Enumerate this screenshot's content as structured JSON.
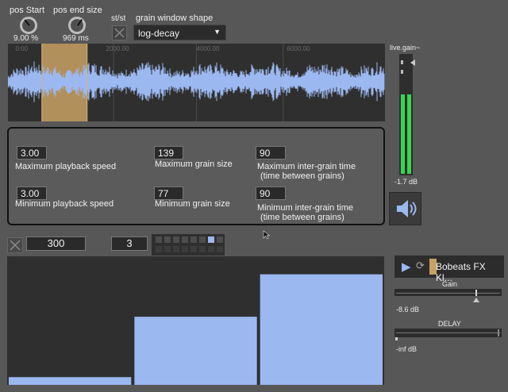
{
  "params": {
    "pos_start": {
      "label": "pos Start",
      "value": "9.00 %"
    },
    "pos_end_size": {
      "label": "pos end size",
      "value": "969 ms"
    },
    "stst_label": "st/st",
    "grain_window": {
      "label": "grain window shape",
      "selected": "log-decay"
    }
  },
  "waveform": {
    "ruler_ticks": [
      "0:00",
      "2000.00",
      "4000.00",
      "6000.00"
    ],
    "selection_start_fraction": 0.09,
    "selection_end_fraction": 0.21
  },
  "gain_meter": {
    "label": "live.gain~",
    "value": "-1.7 dB",
    "level": 0.8
  },
  "controls": {
    "max_speed": {
      "value": "3.00",
      "label": "Maximum playback speed"
    },
    "max_grain": {
      "value": "139",
      "label": "Maximum grain size"
    },
    "max_inter": {
      "value": "90",
      "label_line1": "Maximum inter-grain time",
      "label_line2": "(time between grains)"
    },
    "min_speed": {
      "value": "3.00",
      "label": "Minimum playback speed"
    },
    "min_grain": {
      "value": "77",
      "label": "Minimum grain size"
    },
    "min_inter": {
      "value": "90",
      "label_line1": "Minimum inter-grain time",
      "label_line2": "(time between grains)"
    }
  },
  "lower": {
    "rate_value": "300",
    "steps_value": "3",
    "active_step": 6
  },
  "bars": {
    "values": [
      0.06,
      0.53,
      0.86
    ],
    "color": "#9bb8f0"
  },
  "player": {
    "filename": "Bobeats FX Kl...",
    "gain_label": "Gain",
    "gain_value": "-8.6 dB",
    "gain_fraction": 0.76,
    "delay_label": "DELAY",
    "delay_value": "-inf dB"
  },
  "colors": {
    "accent_blue": "#9bb8f0",
    "meter_green": "#37d64f",
    "selection": "#c9a164"
  }
}
